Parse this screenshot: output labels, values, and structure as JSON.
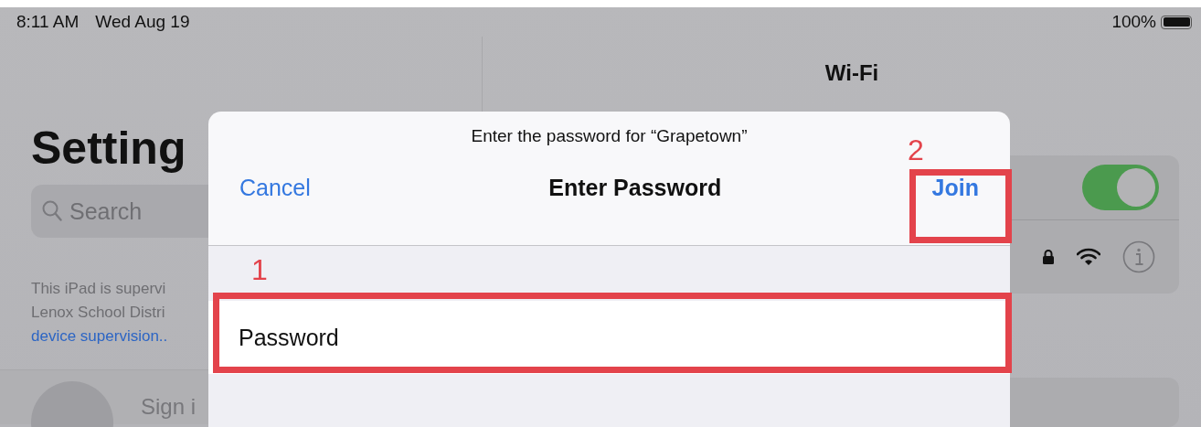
{
  "status_bar": {
    "time": "8:11 AM",
    "date": "Wed Aug 19",
    "battery": "100%"
  },
  "sidebar": {
    "title": "Setting",
    "search": {
      "placeholder": "Search"
    },
    "supervision_note": [
      "This iPad is supervi",
      "Lenox School Distri"
    ],
    "supervision_link": "device supervision..",
    "account_label": "Sign i"
  },
  "detail": {
    "title": "Wi-Fi",
    "wifi_toggle": {
      "on": true
    }
  },
  "dialog": {
    "prompt": "Enter the password for “Grapetown”",
    "cancel": "Cancel",
    "title": "Enter Password",
    "join": "Join",
    "password_field": {
      "placeholder": "Password"
    }
  },
  "annotations": [
    {
      "label": "1"
    },
    {
      "label": "2"
    }
  ]
}
